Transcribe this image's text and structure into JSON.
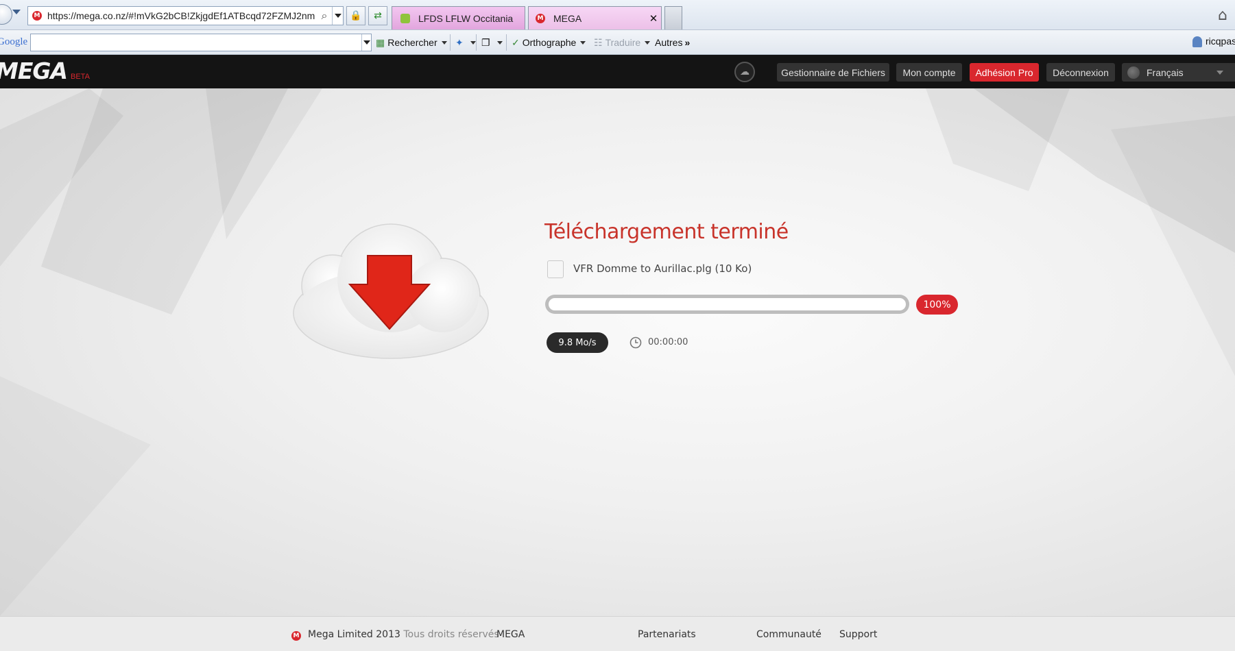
{
  "browser": {
    "address_url": "https://mega.co.nz/#!mVkG2bCB!ZkjgdEf1ATBcqd72FZMJ2nm",
    "tabs": [
      {
        "label": "LFDS LFLW Occitania",
        "active": false
      },
      {
        "label": "MEGA",
        "active": true
      }
    ],
    "toolbar": {
      "google_logo": "Google",
      "search_label": "Rechercher",
      "spelling_label": "Orthographe",
      "translate_label": "Traduire",
      "more_label": "Autres",
      "user_name": "ricqpas"
    }
  },
  "mega_header": {
    "logo": "MEGA",
    "beta": "BETA",
    "nav": {
      "file_manager": "Gestionnaire de Fichiers",
      "account": "Mon compte",
      "pro": "Adhésion Pro",
      "logout": "Déconnexion",
      "language": "Français"
    }
  },
  "download": {
    "title": "Téléchargement terminé",
    "file_name": "VFR Domme to Aurillac.plg (10 Ko)",
    "progress": 1.0,
    "percent_label": "100%",
    "speed": "9.8 Mo/s",
    "time_remaining": "00:00:00"
  },
  "footer": {
    "company": "Mega Limited 2013",
    "rights": "Tous droits réservés",
    "columns": [
      "MEGA",
      "Partenariats",
      "Communauté",
      "Support"
    ]
  },
  "colors": {
    "accent_red": "#d9272e",
    "title_red": "#c8332a",
    "header_bg": "#141414"
  }
}
